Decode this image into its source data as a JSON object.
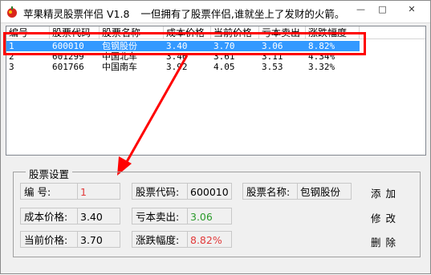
{
  "window": {
    "title": "苹果精灵股票伴侣 V1.8",
    "slogan": "一但拥有了股票伴侣,谁就坐上了发财的火箭。",
    "min_glyph": "—",
    "max_glyph": "□",
    "close_glyph": "✕"
  },
  "table": {
    "columns": [
      "编号",
      "股票代码",
      "股票名称",
      "成本价格",
      "当前价格",
      "亏本卖出",
      "涨跌幅度"
    ],
    "rows": [
      [
        "1",
        "600010",
        "包钢股份",
        "3.40",
        "3.70",
        "3.06",
        "8.82%"
      ],
      [
        "2",
        "601299",
        "中国北车",
        "3.46",
        "3.61",
        "3.11",
        "4.34%"
      ],
      [
        "3",
        "601766",
        "中国南车",
        "3.92",
        "4.05",
        "3.53",
        "3.32%"
      ]
    ],
    "selected_row": 0
  },
  "settings": {
    "group_title": "股票设置",
    "id_label": "编   号:",
    "id_value": "1",
    "code_label": "股票代码:",
    "code_value": "600010",
    "name_label": "股票名称:",
    "name_value": "包钢股份",
    "cost_label": "成本价格:",
    "cost_value": "3.40",
    "loss_label": "亏本卖出:",
    "loss_value": "3.06",
    "current_label": "当前价格:",
    "current_value": "3.70",
    "change_label": "涨跌幅度:",
    "change_value": "8.82%"
  },
  "buttons": {
    "add": "添加",
    "edit": "修改",
    "delete": "删除"
  },
  "colors": {
    "selection": "#3399ff",
    "highlight_annotation": "#ff0000",
    "positive_red": "#e23a3a",
    "loss_green": "#2a9a2a"
  }
}
